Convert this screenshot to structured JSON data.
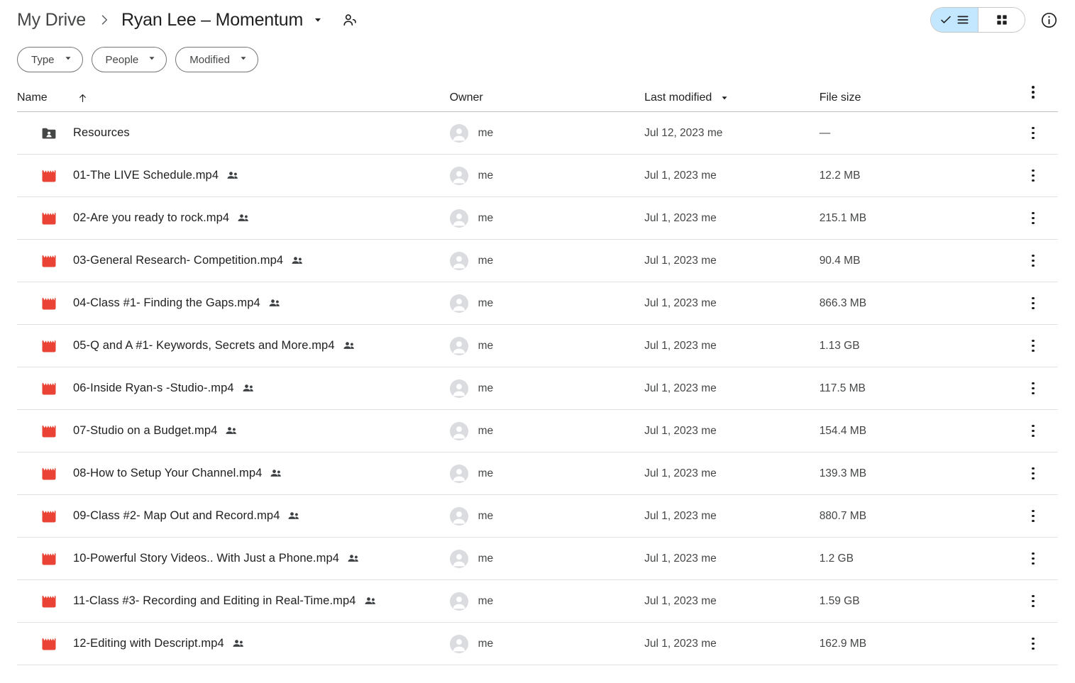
{
  "breadcrumb": {
    "root": "My Drive",
    "separator_icon": "chevron-right-icon",
    "current": "Ryan Lee – Momentum",
    "caret_icon": "chevron-down-icon",
    "shared_icon": "people-shared-icon"
  },
  "toolbar": {
    "list_view_icon": "list-view-icon",
    "list_view_check_icon": "check-icon",
    "grid_view_icon": "grid-view-icon",
    "info_icon": "info-circle-icon",
    "list_view_selected": true
  },
  "filters": [
    {
      "label": "Type",
      "icon": "chevron-down-icon"
    },
    {
      "label": "People",
      "icon": "chevron-down-icon"
    },
    {
      "label": "Modified",
      "icon": "chevron-down-icon"
    }
  ],
  "columns": {
    "name": "Name",
    "name_sort_icon": "arrow-up-icon",
    "owner": "Owner",
    "modified": "Last modified",
    "modified_sort_icon": "caret-down-icon",
    "size": "File size",
    "menu_icon": "more-vertical-icon"
  },
  "rows": [
    {
      "icon": "shared-folder-icon",
      "name": "Resources",
      "shared": false,
      "owner": "me",
      "modified": "Jul 12, 2023 me",
      "size": "—"
    },
    {
      "icon": "video-file-icon",
      "name": "01-The LIVE Schedule.mp4",
      "shared": true,
      "owner": "me",
      "modified": "Jul 1, 2023 me",
      "size": "12.2 MB"
    },
    {
      "icon": "video-file-icon",
      "name": "02-Are you ready to rock.mp4",
      "shared": true,
      "owner": "me",
      "modified": "Jul 1, 2023 me",
      "size": "215.1 MB"
    },
    {
      "icon": "video-file-icon",
      "name": "03-General Research- Competition.mp4",
      "shared": true,
      "owner": "me",
      "modified": "Jul 1, 2023 me",
      "size": "90.4 MB"
    },
    {
      "icon": "video-file-icon",
      "name": "04-Class #1- Finding the Gaps.mp4",
      "shared": true,
      "owner": "me",
      "modified": "Jul 1, 2023 me",
      "size": "866.3 MB"
    },
    {
      "icon": "video-file-icon",
      "name": "05-Q and A #1- Keywords, Secrets and More.mp4",
      "shared": true,
      "owner": "me",
      "modified": "Jul 1, 2023 me",
      "size": "1.13 GB"
    },
    {
      "icon": "video-file-icon",
      "name": "06-Inside Ryan-s -Studio-.mp4",
      "shared": true,
      "owner": "me",
      "modified": "Jul 1, 2023 me",
      "size": "117.5 MB"
    },
    {
      "icon": "video-file-icon",
      "name": "07-Studio on a Budget.mp4",
      "shared": true,
      "owner": "me",
      "modified": "Jul 1, 2023 me",
      "size": "154.4 MB"
    },
    {
      "icon": "video-file-icon",
      "name": "08-How to Setup Your Channel.mp4",
      "shared": true,
      "owner": "me",
      "modified": "Jul 1, 2023 me",
      "size": "139.3 MB"
    },
    {
      "icon": "video-file-icon",
      "name": "09-Class #2- Map Out and Record.mp4",
      "shared": true,
      "owner": "me",
      "modified": "Jul 1, 2023 me",
      "size": "880.7 MB"
    },
    {
      "icon": "video-file-icon",
      "name": "10-Powerful Story Videos.. With Just a Phone.mp4",
      "shared": true,
      "owner": "me",
      "modified": "Jul 1, 2023 me",
      "size": "1.2 GB"
    },
    {
      "icon": "video-file-icon",
      "name": "11-Class #3- Recording and Editing in Real-Time.mp4",
      "shared": true,
      "owner": "me",
      "modified": "Jul 1, 2023 me",
      "size": "1.59 GB"
    },
    {
      "icon": "video-file-icon",
      "name": "12-Editing with Descript.mp4",
      "shared": true,
      "owner": "me",
      "modified": "Jul 1, 2023 me",
      "size": "162.9 MB"
    }
  ],
  "colors": {
    "video_icon": "#EA4335",
    "folder_icon": "#444746",
    "selected_chip": "#c2e7ff",
    "text_primary": "#1f1f1f",
    "text_secondary": "#444746",
    "divider": "#e3e3e3"
  }
}
